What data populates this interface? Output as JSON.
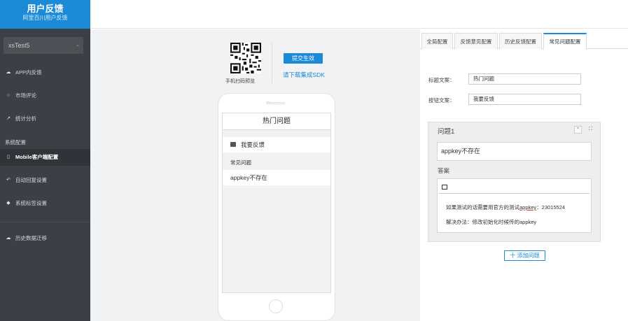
{
  "brand": {
    "title": "用户反馈",
    "subtitle": "阿里百川用户反馈"
  },
  "app_select": {
    "value": "xsTest5"
  },
  "nav": {
    "items": [
      {
        "label": "APP内反馈",
        "icon": "cloud-icon"
      },
      {
        "label": "市场评论",
        "icon": "chat-bubble-icon"
      },
      {
        "label": "统计分析",
        "icon": "line-chart-icon"
      },
      {
        "label": "Mobile客户端配置",
        "icon": "mobile-icon",
        "active": true
      },
      {
        "label": "自动回复设置",
        "icon": "reply-icon"
      },
      {
        "label": "系统标签设置",
        "icon": "tag-icon"
      },
      {
        "label": "历史数据迁移",
        "icon": "cloud-upload-icon"
      }
    ],
    "section_label": "系统配置"
  },
  "preview": {
    "qr_caption": "手机扫码预览",
    "submit_label": "提交生效",
    "sdk_link": "请下载集成SDK"
  },
  "phone_screen": {
    "title": "热门问题",
    "feedback_label": "我要反馈",
    "section_label": "常见问题",
    "question": "appkey不存在"
  },
  "tabs": [
    {
      "label": "全局配置"
    },
    {
      "label": "反馈意见配置"
    },
    {
      "label": "历史反馈配置"
    },
    {
      "label": "常见问题配置",
      "active": true
    }
  ],
  "form": {
    "title_label": "标题文案：",
    "title_value": "热门问题",
    "button_label": "按钮文案：",
    "button_value": "我要反馈"
  },
  "question_card": {
    "title": "问题1",
    "question_value": "appkey不存在",
    "answer_label": "答案",
    "answer_line1_prefix": "如果测试的话需要用官方的测试",
    "answer_line1_link": "appkey",
    "answer_line1_suffix": "：23015524",
    "answer_line2": "解决办法：修改初始化时候传的appkey"
  },
  "add_button": {
    "label": "十 添加问题"
  },
  "colors": {
    "sidebar": "#3a4045",
    "brand": "#1b8bd8",
    "accent": "#1b8bd8"
  }
}
